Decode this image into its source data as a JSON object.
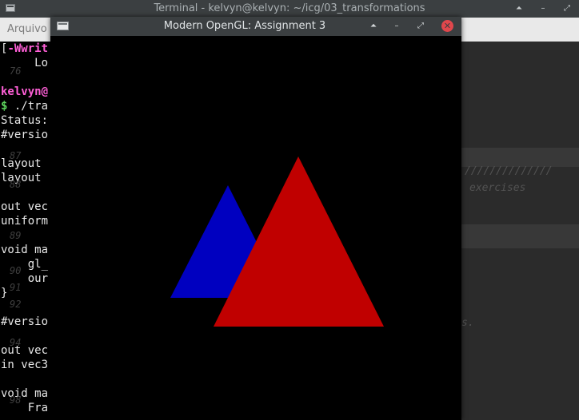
{
  "terminal": {
    "title": "Terminal - kelvyn@kelvyn: ~/icg/03_transformations",
    "menu_first": "Arquivo",
    "lines": [
      {
        "parts": [
          {
            "t": "[",
            "c": ""
          },
          {
            "t": "-Wwrit",
            "c": "pink"
          }
        ]
      },
      {
        "parts": [
          {
            "t": "     Lo",
            "c": ""
          }
        ]
      },
      {
        "parts": [
          {
            "t": "",
            "c": ""
          }
        ]
      },
      {
        "parts": [
          {
            "t": "kelvyn@",
            "c": "pink"
          }
        ]
      },
      {
        "parts": [
          {
            "t": "$ ",
            "c": "green"
          },
          {
            "t": "./tra",
            "c": ""
          }
        ]
      },
      {
        "parts": [
          {
            "t": "Status:",
            "c": ""
          }
        ]
      },
      {
        "parts": [
          {
            "t": "#versio",
            "c": ""
          }
        ]
      },
      {
        "parts": [
          {
            "t": "",
            "c": ""
          }
        ]
      },
      {
        "parts": [
          {
            "t": "layout",
            "c": ""
          }
        ]
      },
      {
        "parts": [
          {
            "t": "layout",
            "c": ""
          }
        ]
      },
      {
        "parts": [
          {
            "t": "",
            "c": ""
          }
        ]
      },
      {
        "parts": [
          {
            "t": "out vec",
            "c": ""
          }
        ]
      },
      {
        "parts": [
          {
            "t": "uniform",
            "c": ""
          }
        ]
      },
      {
        "parts": [
          {
            "t": "",
            "c": ""
          }
        ]
      },
      {
        "parts": [
          {
            "t": "void ma",
            "c": ""
          }
        ]
      },
      {
        "parts": [
          {
            "t": "    gl_",
            "c": ""
          }
        ]
      },
      {
        "parts": [
          {
            "t": "    our",
            "c": ""
          }
        ]
      },
      {
        "parts": [
          {
            "t": "}",
            "c": ""
          }
        ]
      },
      {
        "parts": [
          {
            "t": "",
            "c": ""
          }
        ]
      },
      {
        "parts": [
          {
            "t": "#versio",
            "c": ""
          }
        ]
      },
      {
        "parts": [
          {
            "t": "",
            "c": ""
          }
        ]
      },
      {
        "parts": [
          {
            "t": "out vec",
            "c": ""
          }
        ]
      },
      {
        "parts": [
          {
            "t": "in vec3",
            "c": ""
          }
        ]
      },
      {
        "parts": [
          {
            "t": "",
            "c": ""
          }
        ]
      },
      {
        "parts": [
          {
            "t": "void ma",
            "c": ""
          }
        ]
      },
      {
        "parts": [
          {
            "t": "    Fra",
            "c": ""
          }
        ]
      }
    ],
    "gutter_numbers": [
      "76",
      "87",
      "88",
      "89",
      "90",
      "91",
      "92",
      "94",
      "98"
    ],
    "right_panel_texts": [
      "//////////////",
      "exercises",
      "s."
    ]
  },
  "gl_window": {
    "title": "Modern OpenGL: Assignment 3",
    "buttons": {
      "keep_above": "⏶",
      "minimize": "–",
      "maximize": "⤢",
      "close": "✕"
    },
    "background_color": "#000000",
    "triangles": [
      {
        "name": "blue-triangle",
        "color": "#0000c0"
      },
      {
        "name": "red-triangle",
        "color": "#c00000"
      }
    ]
  }
}
